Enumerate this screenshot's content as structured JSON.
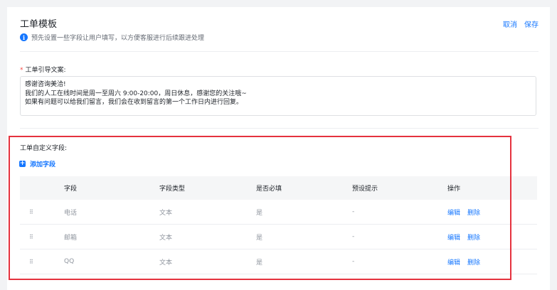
{
  "header": {
    "title": "工单模板",
    "subtitle": "预先设置一些字段让用户填写，以方便客服进行后续跟进处理",
    "cancel_label": "取消",
    "save_label": "保存"
  },
  "guide": {
    "label": "工单引导文案:",
    "required_mark": "*",
    "lines": [
      "感谢咨询美洽!",
      "我们的人工在线时间是周一至周六 9:00-20:00，周日休息，感谢您的关注哦~",
      "如果有问题可以给我们留言，我们会在收到留言的第一个工作日内进行回复。"
    ]
  },
  "custom_fields": {
    "label": "工单自定义字段:",
    "add_label": "添加字段",
    "columns": [
      "字段",
      "字段类型",
      "是否必填",
      "预设提示",
      "操作"
    ],
    "rows": [
      {
        "name": "电话",
        "type": "文本",
        "required": "是",
        "hint": "-",
        "edit": "编辑",
        "delete": "删除"
      },
      {
        "name": "邮箱",
        "type": "文本",
        "required": "是",
        "hint": "-",
        "edit": "编辑",
        "delete": "删除"
      },
      {
        "name": "QQ",
        "type": "文本",
        "required": "是",
        "hint": "-",
        "edit": "编辑",
        "delete": "删除"
      }
    ]
  },
  "colors": {
    "accent": "#1677ff",
    "highlight_border": "#e5323e",
    "required": "#f54a45"
  }
}
